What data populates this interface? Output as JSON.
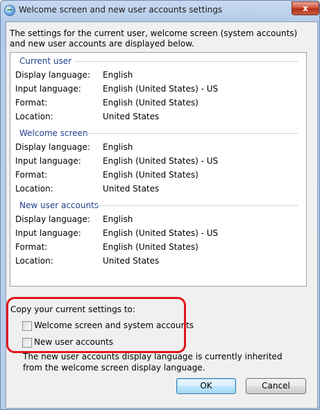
{
  "window": {
    "title": "Welcome screen and new user accounts settings",
    "close_label": "x"
  },
  "intro": "The settings for the current user, welcome screen (system accounts) and new user accounts are displayed below.",
  "sections": [
    {
      "header": "Current user",
      "rows": [
        {
          "label": "Display language:",
          "value": "English"
        },
        {
          "label": "Input language:",
          "value": "English (United States) - US"
        },
        {
          "label": "Format:",
          "value": "English (United States)"
        },
        {
          "label": "Location:",
          "value": "United States"
        }
      ]
    },
    {
      "header": "Welcome screen",
      "rows": [
        {
          "label": "Display language:",
          "value": "English"
        },
        {
          "label": "Input language:",
          "value": "English (United States) - US"
        },
        {
          "label": "Format:",
          "value": "English (United States)"
        },
        {
          "label": "Location:",
          "value": "United States"
        }
      ]
    },
    {
      "header": "New user accounts",
      "rows": [
        {
          "label": "Display language:",
          "value": "English"
        },
        {
          "label": "Input language:",
          "value": "English (United States) - US"
        },
        {
          "label": "Format:",
          "value": "English (United States)"
        },
        {
          "label": "Location:",
          "value": "United States"
        }
      ]
    }
  ],
  "copy": {
    "label": "Copy your current settings to:",
    "options": [
      {
        "label": "Welcome screen and system accounts",
        "checked": false
      },
      {
        "label": "New user accounts",
        "checked": false
      }
    ]
  },
  "note": "The new user accounts display language is currently inherited from the welcome screen display language.",
  "buttons": {
    "ok": "OK",
    "cancel": "Cancel"
  },
  "colors": {
    "section_header": "#1e3f8a",
    "highlight": "#e0161d"
  }
}
